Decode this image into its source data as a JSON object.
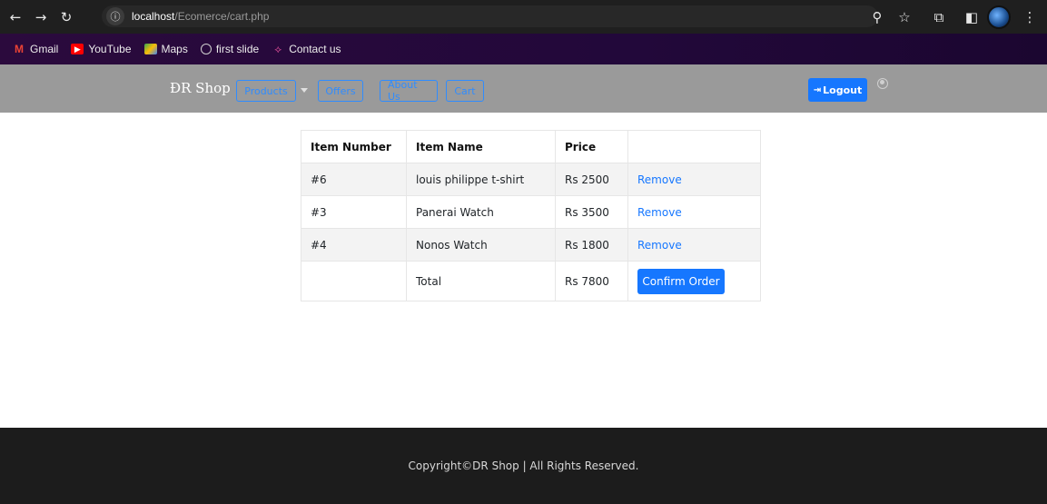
{
  "browser": {
    "url_host": "localhost",
    "url_path": "/Ecomerce/cart.php",
    "bookmarks": [
      {
        "label": "Gmail",
        "color": "#ea4335"
      },
      {
        "label": "YouTube",
        "color": "#ff0000"
      },
      {
        "label": "Maps",
        "color": "#34a853"
      },
      {
        "label": "first slide",
        "color": "#9aa0a6"
      },
      {
        "label": "Contact us",
        "color": "#e04e9a"
      }
    ]
  },
  "navbar": {
    "brand": "ÐR Shop",
    "links": [
      "Products",
      "Offers",
      "About Us",
      "Cart"
    ],
    "logout_label": "Logout",
    "accent": "#1677ff"
  },
  "cart": {
    "headers": [
      "Item Number",
      "Item Name",
      "Price",
      ""
    ],
    "rows": [
      {
        "number": "#6",
        "name": "louis philippe t-shirt",
        "price": "Rs 2500",
        "action": "Remove"
      },
      {
        "number": "#3",
        "name": "Panerai Watch",
        "price": "Rs 3500",
        "action": "Remove"
      },
      {
        "number": "#4",
        "name": "Nonos Watch",
        "price": "Rs 1800",
        "action": "Remove"
      }
    ],
    "total_label": "Total",
    "total_value": "Rs 7800",
    "confirm_label": "Confirm Order"
  },
  "footer": {
    "text": "Copyright©DR Shop | All Rights Reserved."
  }
}
